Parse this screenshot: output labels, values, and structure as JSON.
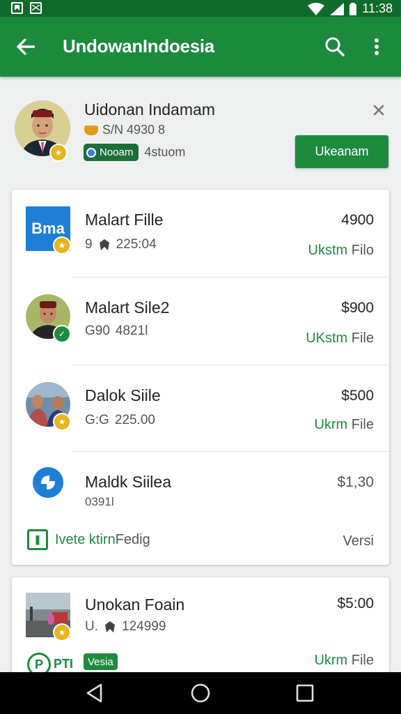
{
  "status_bar": {
    "time": "11:38"
  },
  "toolbar": {
    "title": "UndowanIndoesia"
  },
  "profile": {
    "name": "Uidonan Indamam",
    "subtitle": "S/N 4930 8",
    "tag_label": "Nooam",
    "tag_extra": "4stuom",
    "action_label": "Ukeanam"
  },
  "items": [
    {
      "title": "Malart Fille",
      "sub": "225:04",
      "sub_prefix": "9",
      "price": "4900",
      "action_green": "Ukstm",
      "action_gray": "Filo"
    },
    {
      "title": "Malart Sile2",
      "sub": "4821l",
      "sub_prefix": "G90",
      "price": "$900",
      "action_green": "UKstm",
      "action_gray": "File"
    },
    {
      "title": "Dalok Siile",
      "sub": "225.00",
      "sub_prefix": "G:G",
      "price": "$500",
      "action_green": "Ukrm",
      "action_gray": "File"
    },
    {
      "title": "Maldk Siilea",
      "sub": "0391l",
      "sub_prefix": "",
      "price": "$1,30",
      "action_green": "",
      "action_gray": ""
    }
  ],
  "card1_footer": {
    "link_green": "Ivete ktirn",
    "link_gray": "Fedig",
    "version": "Versi"
  },
  "card2": {
    "title": "Unokan Foain",
    "sub_prefix": "U.",
    "sub": "124999",
    "price": "$5:00",
    "tag": "Vesia",
    "p_label": "PTI",
    "action_green": "Ukrm",
    "action_gray": "File"
  },
  "icons": {
    "thumb1_text": "Bma"
  },
  "colors": {
    "status_bar": "#0f6b2c",
    "toolbar": "#1b8a3c",
    "accent": "#1e8a3e",
    "badge_gold": "#e6b51f"
  }
}
